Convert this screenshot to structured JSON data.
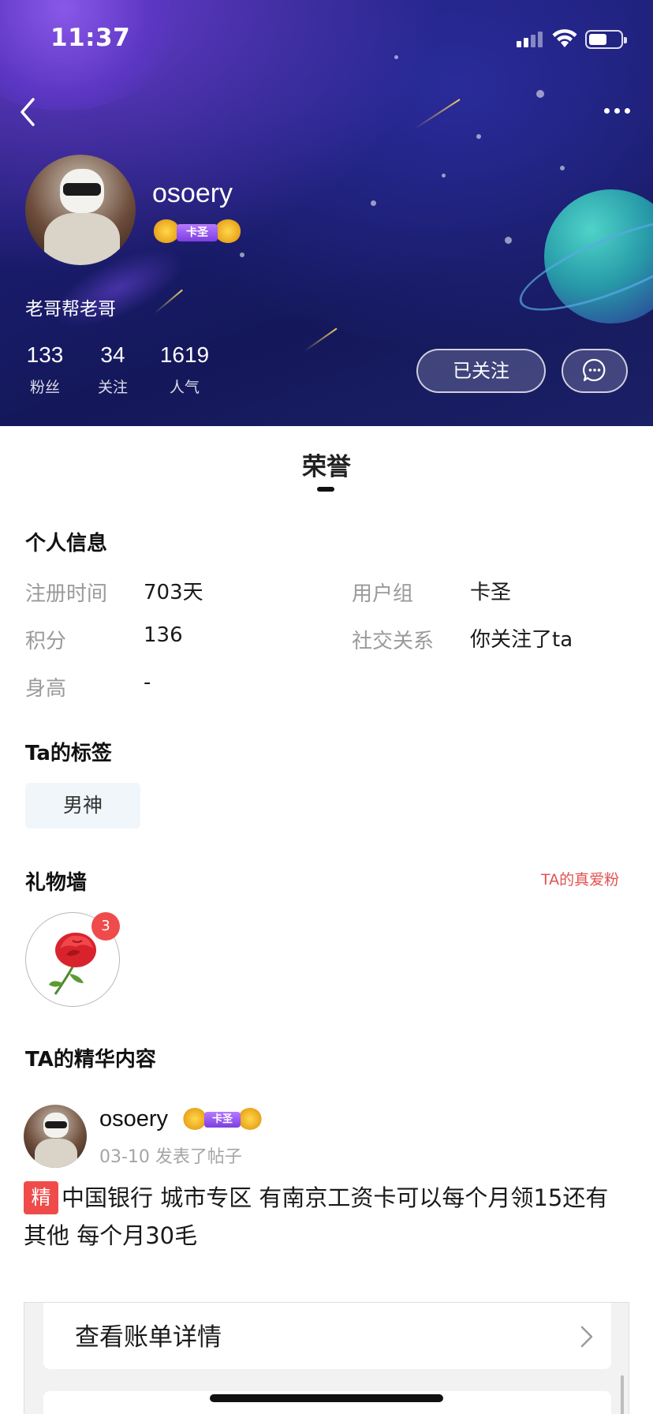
{
  "status_bar": {
    "time": "11:37"
  },
  "profile": {
    "username": "osoery",
    "badge_text": "卡圣",
    "signature": "老哥帮老哥",
    "stats": [
      {
        "value": "133",
        "label": "粉丝"
      },
      {
        "value": "34",
        "label": "关注"
      },
      {
        "value": "1619",
        "label": "人气"
      }
    ],
    "follow_button": "已关注"
  },
  "tab": {
    "title": "荣誉"
  },
  "personal_info": {
    "title": "个人信息",
    "rows": [
      {
        "label": "注册时间",
        "value": "703天"
      },
      {
        "label": "用户组",
        "value": "卡圣"
      },
      {
        "label": "积分",
        "value": "136"
      },
      {
        "label": "社交关系",
        "value": "你关注了ta"
      },
      {
        "label": "身高",
        "value": "-"
      }
    ]
  },
  "tags": {
    "title": "Ta的标签",
    "items": [
      "男神"
    ]
  },
  "gift_wall": {
    "title": "礼物墙",
    "link": "TA的真爱粉",
    "gift_count": "3"
  },
  "featured": {
    "title": "TA的精华内容",
    "post": {
      "username": "osoery",
      "badge_text": "卡圣",
      "meta": "03-10 发表了帖子",
      "flag": "精",
      "text": "中国银行 城市专区 有南京工资卡可以每个月领15还有其他 每个月30毛",
      "preview_label": "查看账单详情"
    }
  },
  "colors": {
    "accent_red": "#ef4b4b",
    "badge_purple": "#9b5cf0",
    "hero_bg": "#1b1d6a"
  }
}
